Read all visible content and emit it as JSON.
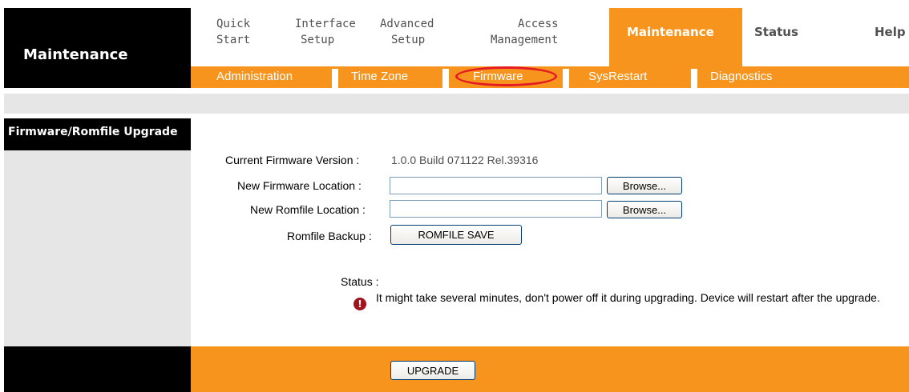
{
  "header": {
    "section_title": "Maintenance",
    "tabs": [
      {
        "line1": "Quick",
        "line2": "Start"
      },
      {
        "line1": "Interface",
        "line2": "Setup"
      },
      {
        "line1": "Advanced",
        "line2": "Setup"
      },
      {
        "line1": "Access",
        "line2": "Management"
      },
      {
        "line1": "Maintenance",
        "line2": ""
      },
      {
        "line1": "Status",
        "line2": ""
      },
      {
        "line1": "Help",
        "line2": ""
      }
    ],
    "active_tab": "Maintenance"
  },
  "subnav": {
    "items": [
      "Administration",
      "Time Zone",
      "Firmware",
      "SysRestart",
      "Diagnostics"
    ],
    "highlighted": "Firmware"
  },
  "sidebar": {
    "title": "Firmware/Romfile Upgrade"
  },
  "form": {
    "current_version_label": "Current Firmware Version :",
    "current_version_value": "1.0.0 Build 071122 Rel.39316",
    "new_firmware_label": "New Firmware Location :",
    "new_firmware_value": "",
    "new_romfile_label": "New Romfile Location :",
    "new_romfile_value": "",
    "browse_label": "Browse...",
    "romfile_backup_label": "Romfile Backup :",
    "romfile_save_label": "ROMFILE SAVE",
    "status_label": "Status :",
    "status_message": "It might take several minutes, don't power off it during upgrading. Device will restart after the upgrade."
  },
  "footer": {
    "upgrade_label": "UPGRADE"
  },
  "colors": {
    "accent": "#F7941D",
    "header_black": "#000000",
    "panel_gray": "#E6E6E6",
    "highlight_circle": "#E41B23",
    "warning_icon": "#A0141E"
  },
  "icons": {
    "warning": "exclamation-circle-icon"
  }
}
